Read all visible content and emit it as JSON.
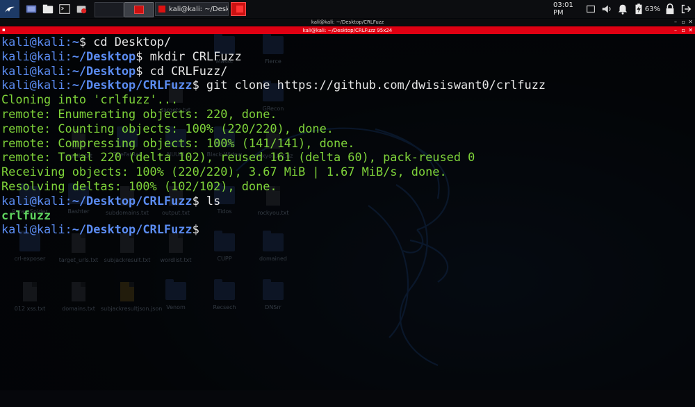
{
  "panel": {
    "taskbar_title": "kali@kali: ~/Desktop/CR...",
    "clock": "03:01 PM",
    "battery": "63%",
    "icons": [
      "kali-menu-icon",
      "desktop-icon",
      "file-manager-icon",
      "terminal-icon",
      "screenshot-icon"
    ]
  },
  "terminal": {
    "window_title": "kali@kali: ~/Desktop/CRLFuzz",
    "tab_title": "kali@kali: ~/Desktop/CRLFuzz 95x24",
    "colors": {
      "prompt_blue": "#5b8cf2",
      "output_green": "#7fd43a",
      "red_bar": "#e00012"
    },
    "lines": [
      {
        "kind": "cmd",
        "user": "kali@kali",
        "path": "~",
        "cmd": " cd Desktop/"
      },
      {
        "kind": "cmd",
        "user": "kali@kali",
        "path": "~/Desktop",
        "cmd": " mkdir CRLFuzz"
      },
      {
        "kind": "cmd",
        "user": "kali@kali",
        "path": "~/Desktop",
        "cmd": " cd CRLFuzz/"
      },
      {
        "kind": "cmd",
        "user": "kali@kali",
        "path": "~/Desktop/CRLFuzz",
        "cmd": " git clone https://github.com/dwisiswant0/crlfuzz"
      },
      {
        "kind": "out",
        "text": "Cloning into 'crlfuzz'..."
      },
      {
        "kind": "out",
        "text": "remote: Enumerating objects: 220, done."
      },
      {
        "kind": "out",
        "text": "remote: Counting objects: 100% (220/220), done."
      },
      {
        "kind": "out",
        "text": "remote: Compressing objects: 100% (141/141), done."
      },
      {
        "kind": "out",
        "text": "remote: Total 220 (delta 102), reused 161 (delta 60), pack-reused 0"
      },
      {
        "kind": "out",
        "text": "Receiving objects: 100% (220/220), 3.67 MiB | 1.67 MiB/s, done."
      },
      {
        "kind": "out",
        "text": "Resolving deltas: 100% (102/102), done."
      },
      {
        "kind": "cmd",
        "user": "kali@kali",
        "path": "~/Desktop/CRLFuzz",
        "cmd": " ls"
      },
      {
        "kind": "dir",
        "text": "crlfuzz"
      },
      {
        "kind": "cmd",
        "user": "kali@kali",
        "path": "~/Desktop/CRLFuzz",
        "cmd": ""
      }
    ]
  },
  "desktop_icons": [
    {
      "label": "Massc",
      "type": "folder"
    },
    {
      "label": "Fierce",
      "type": "folder"
    },
    {
      "label": "targets.txt",
      "type": "file"
    },
    {
      "label": "GRecon",
      "type": "folder"
    },
    {
      "label": "emails.txt",
      "type": "file"
    },
    {
      "label": "TheFatRat",
      "type": "folder"
    },
    {
      "label": "NUUBI",
      "type": "folder"
    },
    {
      "label": "Black-Widow",
      "type": "folder"
    },
    {
      "label": "rockyou.txt.gz",
      "type": "file"
    },
    {
      "label": "ParamSpider",
      "type": "folder"
    },
    {
      "label": "Bashter",
      "type": "folder"
    },
    {
      "label": "subdomains.txt",
      "type": "file"
    },
    {
      "label": "output.txt",
      "type": "file"
    },
    {
      "label": "Tidos",
      "type": "folder"
    },
    {
      "label": "rockyou.txt",
      "type": "file"
    },
    {
      "label": "crl-exposer",
      "type": "folder"
    },
    {
      "label": "target_urls.txt",
      "type": "file"
    },
    {
      "label": "subjackresult.txt",
      "type": "file"
    },
    {
      "label": "wordlist.txt",
      "type": "file"
    },
    {
      "label": "CUPP",
      "type": "folder"
    },
    {
      "label": "domained",
      "type": "folder"
    },
    {
      "label": "012 xss.txt",
      "type": "file"
    },
    {
      "label": "domains.txt",
      "type": "file"
    },
    {
      "label": "subjackresultjson.json",
      "type": "file-gold"
    },
    {
      "label": "Venom",
      "type": "folder"
    },
    {
      "label": "Recsech",
      "type": "folder"
    },
    {
      "label": "DNSrr",
      "type": "folder"
    }
  ]
}
